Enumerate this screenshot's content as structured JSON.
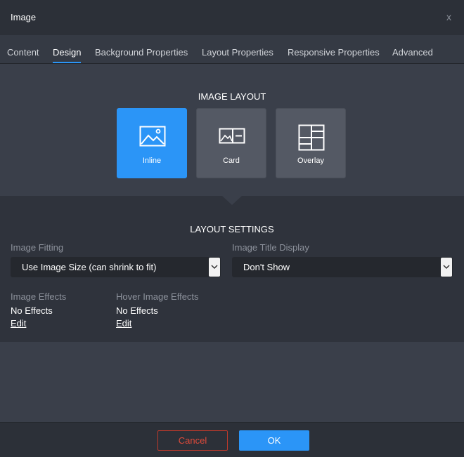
{
  "window": {
    "title": "Image",
    "close_label": "x"
  },
  "tabs": [
    {
      "label": "Content"
    },
    {
      "label": "Design",
      "active": true
    },
    {
      "label": "Background Properties"
    },
    {
      "label": "Layout Properties"
    },
    {
      "label": "Responsive Properties"
    },
    {
      "label": "Advanced"
    }
  ],
  "image_layout": {
    "heading": "IMAGE LAYOUT",
    "options": [
      {
        "label": "Inline",
        "icon": "image-icon",
        "selected": true
      },
      {
        "label": "Card",
        "icon": "card-layout-icon"
      },
      {
        "label": "Overlay",
        "icon": "overlay-layout-icon"
      }
    ]
  },
  "layout_settings": {
    "heading": "LAYOUT SETTINGS",
    "image_fitting": {
      "label": "Image Fitting",
      "value": "Use Image Size (can shrink to fit)"
    },
    "image_title_display": {
      "label": "Image Title Display",
      "value": "Don't Show"
    },
    "image_effects": {
      "label": "Image Effects",
      "value": "No Effects",
      "edit_label": "Edit"
    },
    "hover_image_effects": {
      "label": "Hover Image Effects",
      "value": "No Effects",
      "edit_label": "Edit"
    }
  },
  "footer": {
    "cancel_label": "Cancel",
    "ok_label": "OK"
  },
  "colors": {
    "accent": "#2b95f7",
    "cancel": "#e04a3a",
    "background": "#3a3f4a",
    "panel": "#2f333c"
  }
}
